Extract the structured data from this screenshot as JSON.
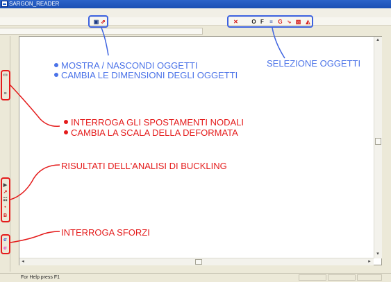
{
  "window": {
    "title": "SARGON_READER",
    "mdi_minimize": "_",
    "mdi_restore": "ȸ",
    "mdi_close": "×"
  },
  "toolbar_top_left": {
    "items": [
      {
        "name": "show-hide-objects-icon",
        "glyph": "▣",
        "color": "#1d3c86"
      },
      {
        "name": "resize-objects-icon",
        "glyph": "⇗",
        "color": "#d01a1a"
      }
    ]
  },
  "toolbar_top_right": {
    "items": [
      {
        "name": "select-x-icon",
        "glyph": "✕",
        "color": "#d41515"
      },
      {
        "name": "select-o-icon",
        "glyph": "O",
        "color": "#222222"
      },
      {
        "name": "select-f-icon",
        "glyph": "F",
        "color": "#222222"
      },
      {
        "name": "select-layers-icon",
        "glyph": "≡",
        "color": "#2a4fa8"
      },
      {
        "name": "select-g-icon",
        "glyph": "G",
        "color": "#d41515"
      },
      {
        "name": "select-node-icon",
        "glyph": "⤷",
        "color": "#d41515"
      },
      {
        "name": "select-element-icon",
        "glyph": "▧",
        "color": "#d41515"
      },
      {
        "name": "select-load-icon",
        "glyph": "◭",
        "color": "#d41515"
      }
    ]
  },
  "left_toolbar": {
    "items": [
      {
        "name": "displacement-query-icon",
        "glyph": "▭",
        "color": "#6a6a6a"
      },
      {
        "name": "deformation-scale-icon",
        "glyph": "≡",
        "color": "#444444"
      },
      {
        "name": "buckling-result-1-icon",
        "glyph": "▶",
        "color": "#444444"
      },
      {
        "name": "buckling-result-2-icon",
        "glyph": "↗",
        "color": "#d41515"
      },
      {
        "name": "buckling-result-3-icon",
        "glyph": "☷",
        "color": "#444444"
      },
      {
        "name": "buckling-result-4-icon",
        "glyph": "•",
        "color": "#d41515"
      },
      {
        "name": "buckling-result-5-icon",
        "glyph": "B",
        "color": "#d41515"
      },
      {
        "name": "stress-query-1-icon",
        "glyph": "σ",
        "color": "#2a4fd0"
      },
      {
        "name": "stress-query-2-icon",
        "glyph": "σ",
        "color": "#d42bc4"
      }
    ]
  },
  "annotations": {
    "show_hide": "MOSTRA / NASCONDI OGGETTI",
    "resize": "CAMBIA LE DIMENSIONI DEGLI OGGETTI",
    "selection": "SELEZIONE OGGETTI",
    "query_displacements": "INTERROGA GLI SPOSTAMENTI NODALI",
    "deformed_scale": "CAMBIA LA SCALA DELLA DEFORMATA",
    "buckling": "RISULTATI DELL'ANALISI DI BUCKLING",
    "stress": "INTERROGA SFORZI"
  },
  "scroll": {
    "left_arrow": "◂",
    "right_arrow": "▸",
    "up_arrow": "▴",
    "down_arrow": "▾"
  },
  "status": {
    "help_text": "For Help press F1"
  },
  "colors": {
    "annotation_blue": "#4a72e8",
    "annotation_red": "#e41b1b",
    "titlebar": "#2b63c9"
  }
}
